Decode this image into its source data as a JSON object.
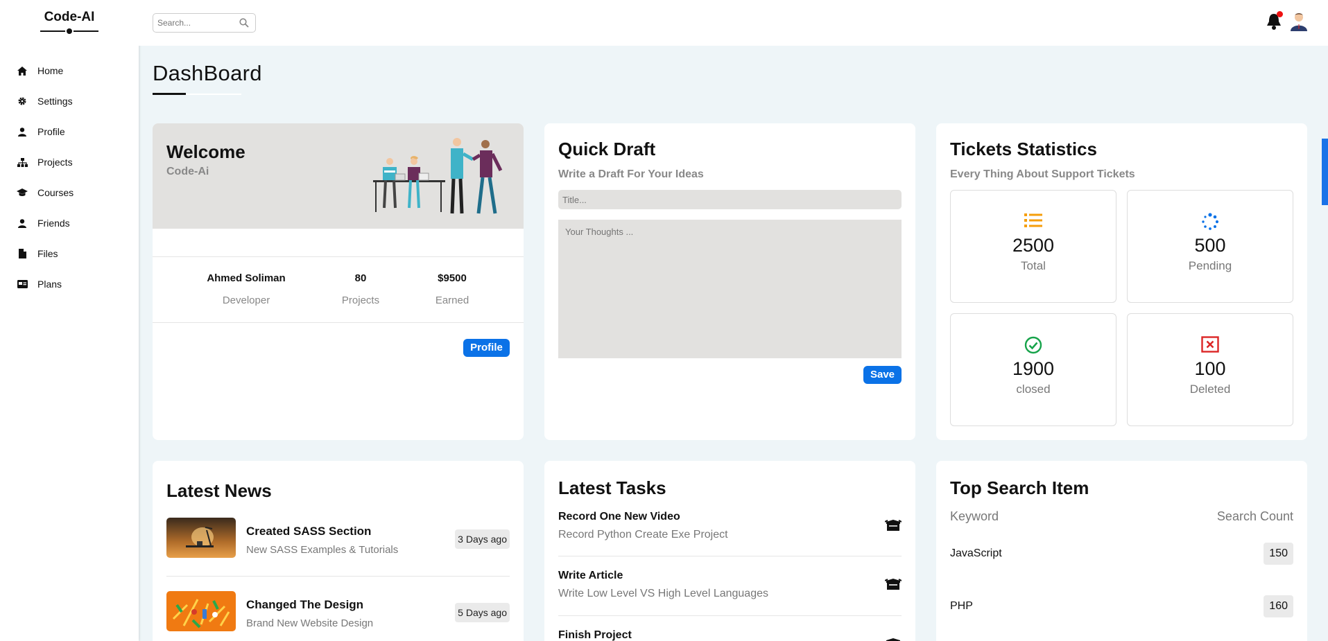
{
  "app": {
    "logo": "Code-AI"
  },
  "sidebar": {
    "items": [
      {
        "label": "Home",
        "icon": "home-icon"
      },
      {
        "label": "Settings",
        "icon": "gear-icon"
      },
      {
        "label": "Profile",
        "icon": "user-icon"
      },
      {
        "label": "Projects",
        "icon": "sitemap-icon"
      },
      {
        "label": "Courses",
        "icon": "graduation-cap-icon"
      },
      {
        "label": "Friends",
        "icon": "user-icon"
      },
      {
        "label": "Files",
        "icon": "file-icon"
      },
      {
        "label": "Plans",
        "icon": "credit-card-icon"
      }
    ]
  },
  "header": {
    "search_placeholder": "Search...",
    "notification_color": "#e11111"
  },
  "page": {
    "title": "DashBoard"
  },
  "welcome": {
    "title": "Welcome",
    "subtitle": "Code-Ai",
    "name": "Ahmed Soliman",
    "role": "Developer",
    "projects_value": "80",
    "projects_label": "Projects",
    "earned_value": "$9500",
    "earned_label": "Earned",
    "profile_button": "Profile"
  },
  "draft": {
    "title": "Quick Draft",
    "subtitle": "Write a Draft For Your Ideas",
    "title_placeholder": "Title...",
    "body_placeholder": "Your Thoughts ...",
    "save_button": "Save"
  },
  "tickets": {
    "title": "Tickets Statistics",
    "subtitle": "Every Thing About Support Tickets",
    "stats": [
      {
        "value": "2500",
        "label": "Total",
        "icon": "list-icon",
        "color": "#f59e0b"
      },
      {
        "value": "500",
        "label": "Pending",
        "icon": "spinner-icon",
        "color": "#0b72e7"
      },
      {
        "value": "1900",
        "label": "closed",
        "icon": "check-circle-icon",
        "color": "#16a34a"
      },
      {
        "value": "100",
        "label": "Deleted",
        "icon": "x-square-icon",
        "color": "#dc2626"
      }
    ]
  },
  "news": {
    "title": "Latest News",
    "items": [
      {
        "title": "Created SASS Section",
        "desc": "New SASS Examples & Tutorials",
        "date": "3 Days ago"
      },
      {
        "title": "Changed The Design",
        "desc": "Brand New Website Design",
        "date": "5 Days ago"
      }
    ]
  },
  "tasks": {
    "title": "Latest Tasks",
    "items": [
      {
        "title": "Record One New Video",
        "desc": "Record Python Create Exe Project"
      },
      {
        "title": "Write Article",
        "desc": "Write Low Level VS High Level Languages"
      },
      {
        "title": "Finish Project",
        "desc": ""
      }
    ]
  },
  "topsearch": {
    "title": "Top Search Item",
    "col_keyword": "Keyword",
    "col_count": "Search Count",
    "rows": [
      {
        "keyword": "JavaScript",
        "count": "150"
      },
      {
        "keyword": "PHP",
        "count": "160"
      }
    ]
  },
  "colors": {
    "accent": "#0b72e7",
    "page_bg": "#eef5f8"
  }
}
